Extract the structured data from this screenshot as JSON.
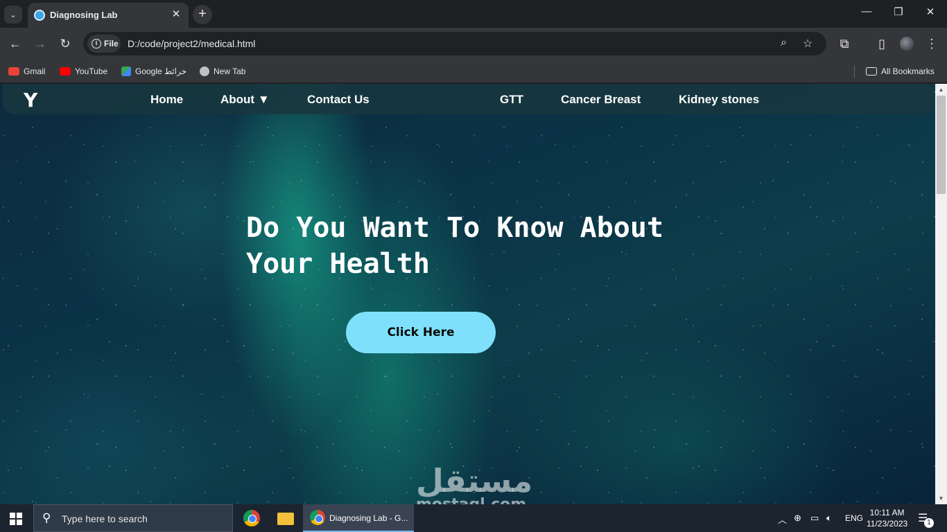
{
  "browser": {
    "tab": {
      "title": "Diagnosing Lab"
    },
    "address": {
      "scheme_chip": "File",
      "url": "D:/code/project2/medical.html"
    },
    "bookmarks": [
      {
        "label": "Gmail",
        "icon": "gmail-icon",
        "color": "#ea4335"
      },
      {
        "label": "YouTube",
        "icon": "youtube-icon",
        "color": "#ff0000"
      },
      {
        "label": "Google خرائط",
        "icon": "maps-icon",
        "color": "#34a853"
      },
      {
        "label": "New Tab",
        "icon": "globe-icon",
        "color": "#e8eaed"
      }
    ],
    "all_bookmarks": "All Bookmarks"
  },
  "page": {
    "logo": "Y",
    "nav": {
      "home": "Home",
      "about": "About ▼",
      "contact": "Contact Us",
      "gtt": "GTT",
      "cancer": "Cancer Breast",
      "kidney": "Kidney stones"
    },
    "hero": {
      "title": "Do You Want To Know About Your Health",
      "button": "Click Here"
    },
    "watermark": {
      "arabic": "مستقل",
      "latin": "mostaql.com"
    }
  },
  "taskbar": {
    "search_placeholder": "Type here to search",
    "active_window": "Diagnosing Lab - G...",
    "language": "ENG",
    "time": "10:11 AM",
    "date": "11/23/2023",
    "notification_count": "1"
  },
  "colors": {
    "accent_button": "#7fe0fb",
    "navbar": "#19373e",
    "page_bg": "#0b3346"
  }
}
